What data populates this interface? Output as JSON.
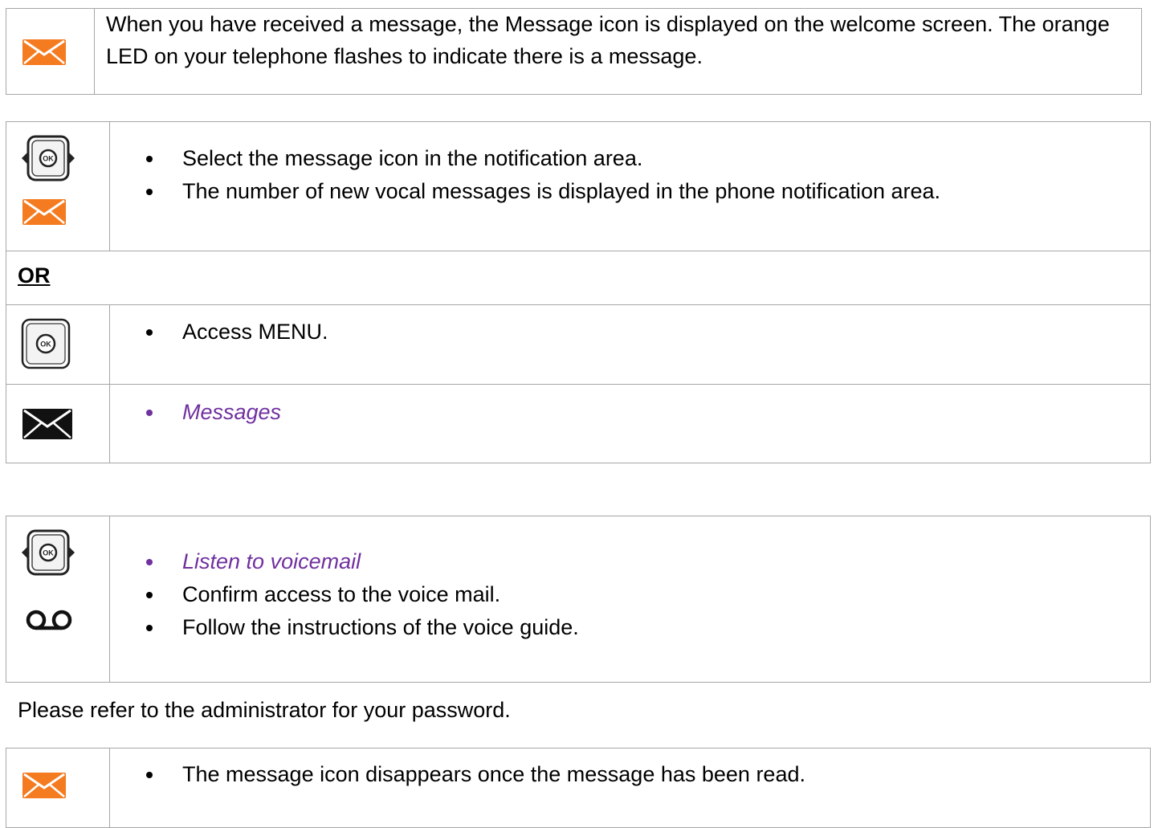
{
  "colors": {
    "accent_orange": "#f47b20",
    "menu_purple": "#7030a0",
    "border_gray": "#a6a6a6"
  },
  "intro": {
    "icon": "envelope-orange-icon",
    "text": "When you have received a message, the Message icon is displayed on the welcome screen. The orange LED on your telephone flashes to indicate there is a message."
  },
  "consult": {
    "row1": {
      "icons": [
        "navigator-ok-arrows-icon",
        "envelope-orange-icon"
      ],
      "bullets": [
        "Select the message icon in the notification area.",
        "The number of new vocal messages is displayed in the phone notification area."
      ]
    },
    "or_label": "OR",
    "row2": {
      "icons": [
        "ok-key-icon"
      ],
      "bullets": [
        "Access MENU."
      ]
    },
    "row3": {
      "icons": [
        "envelope-black-icon"
      ],
      "bullets": [
        "Messages"
      ]
    }
  },
  "voicemail": {
    "icons": [
      "navigator-ok-arrows-icon",
      "voicemail-icon"
    ],
    "bullets": [
      "Listen to voicemail",
      "Confirm access to the voice mail.",
      "Follow the instructions of the voice guide."
    ]
  },
  "note": "Please refer to the administrator for your password.",
  "final": {
    "icons": [
      "envelope-orange-icon"
    ],
    "bullets": [
      "The message icon disappears once the message has been read."
    ]
  }
}
